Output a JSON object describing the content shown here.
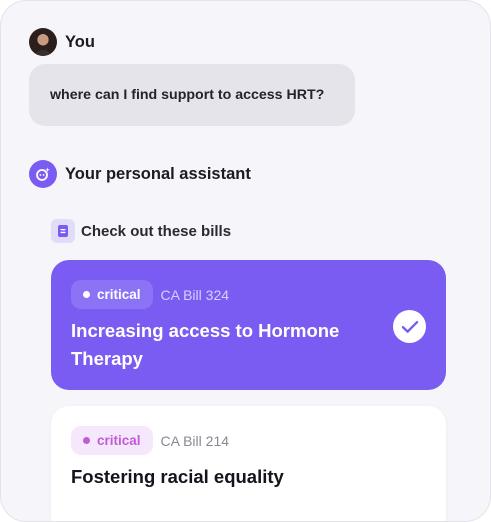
{
  "user": {
    "name": "You",
    "message": "where can I find support to access HRT?"
  },
  "assistant": {
    "name": "Your personal assistant",
    "section_label": "Check out these bills"
  },
  "bills": [
    {
      "badge": "critical",
      "number": "CA Bill 324",
      "title": "Increasing access to Hormone Therapy",
      "selected": true
    },
    {
      "badge": "critical",
      "number": "CA Bill 214",
      "title": "Fostering racial equality",
      "selected": false
    }
  ],
  "colors": {
    "accent": "#7a5cf2",
    "badge_pink": "#c25ad8",
    "bubble": "#e6e4eb",
    "background": "#f6f5f9"
  },
  "icons": {
    "assistant": "assistant-sparkle-icon",
    "section": "document-icon",
    "selected": "checkmark-icon"
  }
}
